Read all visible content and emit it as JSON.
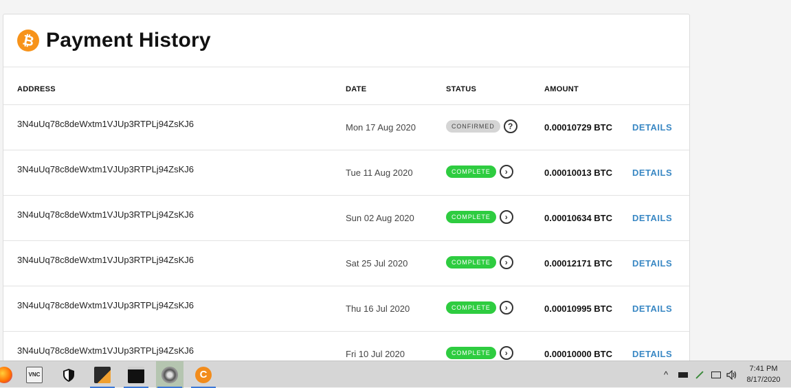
{
  "header": {
    "title": "Payment History",
    "logo_glyph": "₿"
  },
  "columns": {
    "address": "ADDRESS",
    "date": "DATE",
    "status": "STATUS",
    "amount": "AMOUNT"
  },
  "rows": [
    {
      "address": "3N4uUq78c8deWxtm1VJUp3RTPLj94ZsKJ6",
      "date": "Mon 17 Aug 2020",
      "status": "CONFIRMED",
      "status_icon": "?",
      "amount": "0.00010729 BTC",
      "action": "DETAILS"
    },
    {
      "address": "3N4uUq78c8deWxtm1VJUp3RTPLj94ZsKJ6",
      "date": "Tue 11 Aug 2020",
      "status": "COMPLETE",
      "status_icon": "›",
      "amount": "0.00010013 BTC",
      "action": "DETAILS"
    },
    {
      "address": "3N4uUq78c8deWxtm1VJUp3RTPLj94ZsKJ6",
      "date": "Sun 02 Aug 2020",
      "status": "COMPLETE",
      "status_icon": "›",
      "amount": "0.00010634 BTC",
      "action": "DETAILS"
    },
    {
      "address": "3N4uUq78c8deWxtm1VJUp3RTPLj94ZsKJ6",
      "date": "Sat 25 Jul 2020",
      "status": "COMPLETE",
      "status_icon": "›",
      "amount": "0.00012171 BTC",
      "action": "DETAILS"
    },
    {
      "address": "3N4uUq78c8deWxtm1VJUp3RTPLj94ZsKJ6",
      "date": "Thu 16 Jul 2020",
      "status": "COMPLETE",
      "status_icon": "›",
      "amount": "0.00010995 BTC",
      "action": "DETAILS"
    },
    {
      "address": "3N4uUq78c8deWxtm1VJUp3RTPLj94ZsKJ6",
      "date": "Fri 10 Jul 2020",
      "status": "COMPLETE",
      "status_icon": "›",
      "amount": "0.00010000 BTC",
      "action": "DETAILS"
    }
  ],
  "colors": {
    "brand": "#f7931a",
    "complete": "#2ecc40",
    "confirmed": "#d5d5d5",
    "link": "#3a88c4"
  },
  "taskbar": {
    "apps": [
      {
        "name": "firefox-icon"
      },
      {
        "name": "vnc-viewer-icon"
      },
      {
        "name": "security-shield-icon"
      },
      {
        "name": "notes-app-icon"
      },
      {
        "name": "terminal-icon"
      },
      {
        "name": "miner-app-icon"
      },
      {
        "name": "ccleaner-icon"
      }
    ],
    "tray": {
      "chevron": "^",
      "clock_time": "7:41 PM",
      "clock_date": "8/17/2020"
    }
  }
}
